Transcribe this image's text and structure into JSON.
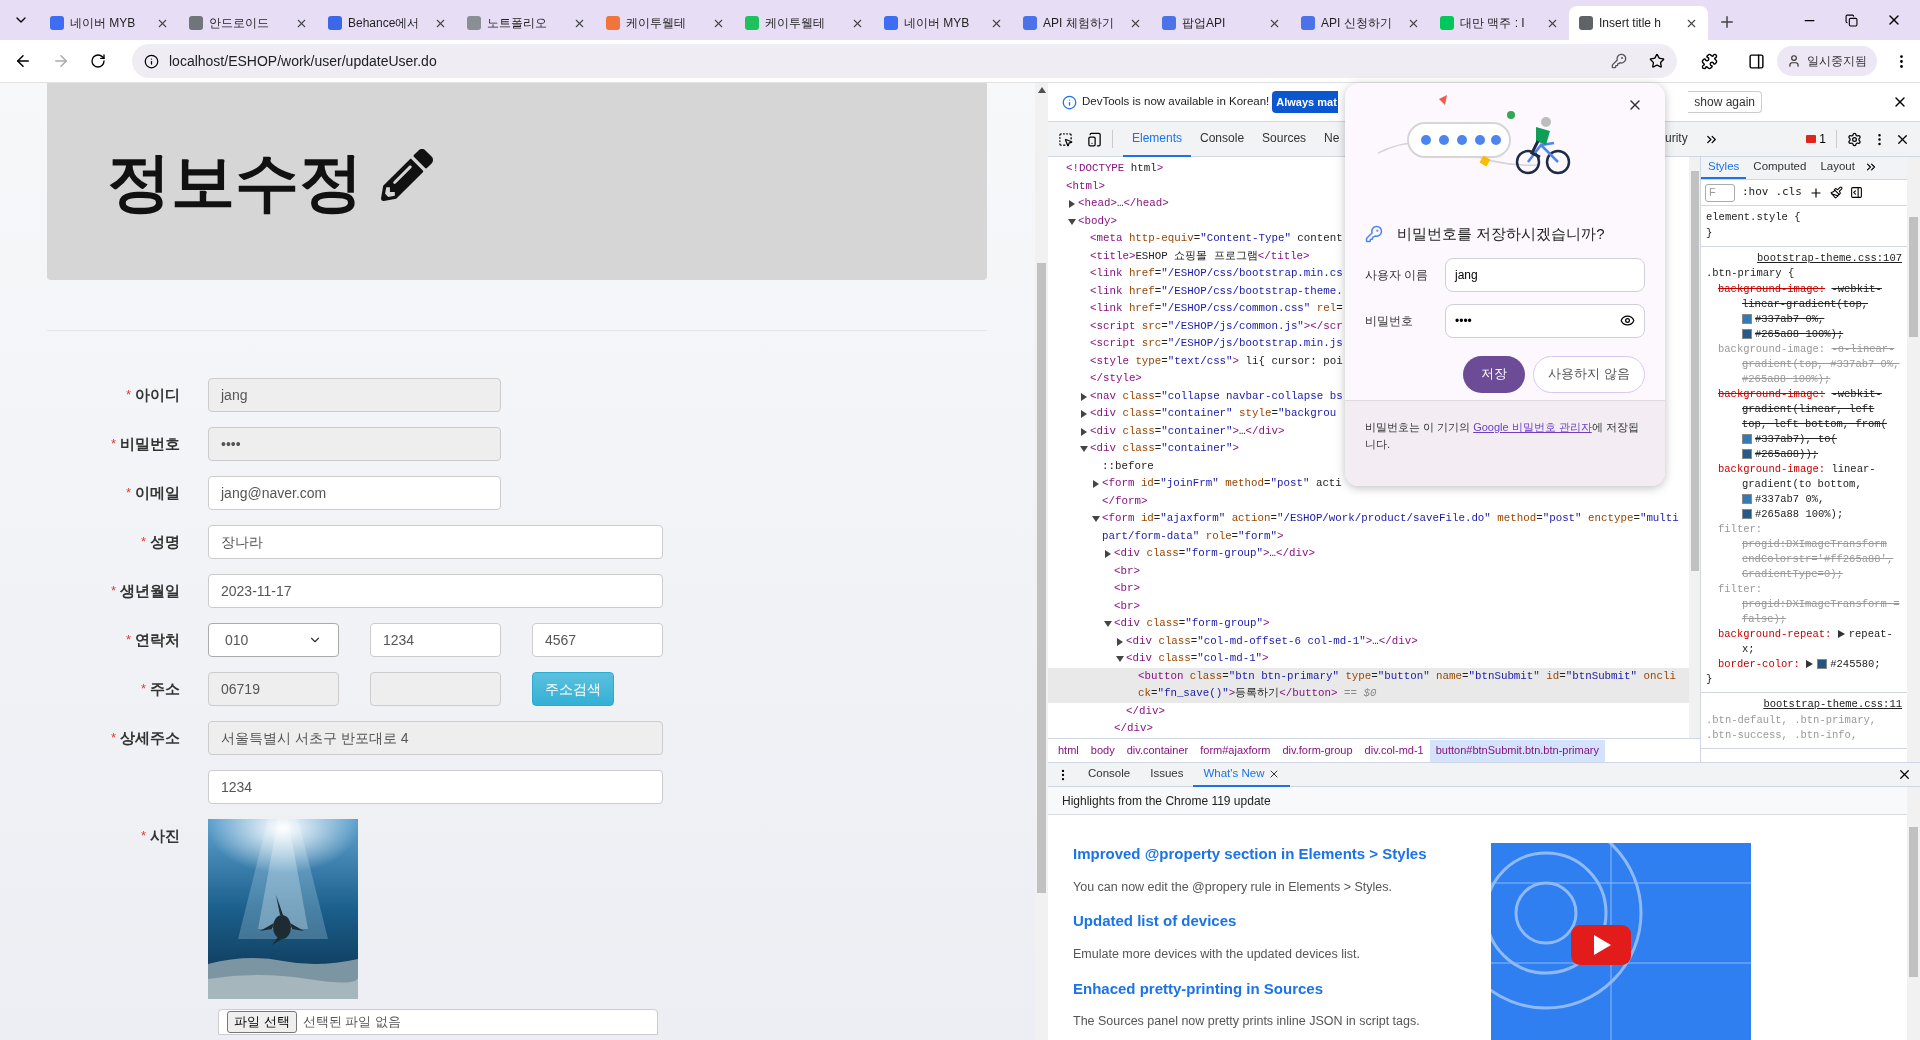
{
  "browser": {
    "tabs": [
      {
        "title": "네이버 MYB",
        "color": "#3d6df2",
        "selected": false
      },
      {
        "title": "안드로이드",
        "color": "#70757a",
        "selected": false
      },
      {
        "title": "Behance에서",
        "color": "#3b68e8",
        "selected": false
      },
      {
        "title": "노트폴리오",
        "color": "#8a8f94",
        "selected": false
      },
      {
        "title": "케이투웰테",
        "color": "#f0743c",
        "selected": false
      },
      {
        "title": "케이투웰테",
        "color": "#1fc15c",
        "selected": false
      },
      {
        "title": "네이버 MYB",
        "color": "#3d6df2",
        "selected": false
      },
      {
        "title": "API 체험하기",
        "color": "#4b72e8",
        "selected": false
      },
      {
        "title": "팝업API",
        "color": "#4b72e8",
        "selected": false
      },
      {
        "title": "API 신청하기",
        "color": "#4b72e8",
        "selected": false
      },
      {
        "title": "대만 맥주 : I",
        "color": "#03c75a",
        "selected": false
      },
      {
        "title": "Insert title h",
        "color": "#5f6368",
        "selected": true
      }
    ],
    "address": "localhost/ESHOP/work/user/updateUser.do",
    "profile": "일시중지됨"
  },
  "page": {
    "title": "정보수정",
    "rows": [
      {
        "label": "아이디",
        "mark": "*",
        "kind": "short",
        "fields": [
          {
            "kind": "input",
            "value": "jang",
            "disabled": true
          }
        ]
      },
      {
        "label": "비밀번호",
        "mark": "*",
        "kind": "short",
        "fields": [
          {
            "kind": "input",
            "value": "••••",
            "disabled": true
          }
        ]
      },
      {
        "label": "이메일",
        "mark": "*",
        "kind": "short",
        "fields": [
          {
            "kind": "input",
            "value": "jang@naver.com",
            "disabled": false
          }
        ]
      },
      {
        "label": "성명",
        "mark": "*",
        "kind": "wide",
        "fields": [
          {
            "kind": "input",
            "value": "장나라",
            "disabled": false
          }
        ]
      },
      {
        "label": "생년월일",
        "mark": "*",
        "kind": "wide",
        "fields": [
          {
            "kind": "input",
            "value": "2023-11-17",
            "disabled": false
          }
        ]
      },
      {
        "label": "연락처",
        "mark": "*",
        "kind": "triple",
        "fields": [
          {
            "kind": "select",
            "value": "010",
            "disabled": false
          },
          {
            "kind": "input",
            "value": "1234",
            "disabled": false
          },
          {
            "kind": "input",
            "value": "4567",
            "disabled": false
          }
        ]
      },
      {
        "label": "주소",
        "mark": "*",
        "kind": "triple",
        "fields": [
          {
            "kind": "input",
            "value": "06719",
            "disabled": true
          },
          {
            "kind": "input",
            "disabled": true
          },
          {
            "kind": "button",
            "value": "주소검색"
          }
        ]
      },
      {
        "label": "상세주소",
        "mark": "*",
        "kind": "wide",
        "fields": [
          {
            "kind": "input",
            "value": "서울특별시 서초구 반포대로 4",
            "disabled": true
          }
        ]
      },
      {
        "kind": "wide",
        "fields": [
          {
            "kind": "input",
            "value": "1234",
            "disabled": false
          }
        ]
      },
      {
        "label": "사진",
        "mark": "*"
      }
    ],
    "file": {
      "button": "파일 선택",
      "status": "선택된 파일 없음"
    }
  },
  "devtools": {
    "infobar": {
      "message": "DevTools is now available in Korean!",
      "primary": "Always mat",
      "secondary": "show again"
    },
    "tabs": [
      {
        "label": "Elements",
        "selected": true
      },
      {
        "label": "Console",
        "selected": false
      },
      {
        "label": "Sources",
        "selected": false
      },
      {
        "label": "Ne",
        "selected": false
      }
    ],
    "tab_right": {
      "label": "urity",
      "selected": false
    },
    "error_count": "1",
    "dom": [
      {
        "text": "<!DOCTYPE html>",
        "selected": false
      },
      {
        "text": "<html>",
        "selected": false,
        "children": [
          {
            "text": "<head>…</head>",
            "expanded": false,
            "selected": false
          },
          {
            "text": "<body>",
            "expanded": true,
            "selected": false,
            "children": [
              {
                "text": "<meta http-equiv=\"Content-Type\" content",
                "selected": false
              },
              {
                "text": "<title>ESHOP 쇼핑몰 프로그램</title>",
                "selected": false
              },
              {
                "text": "<link href=\"/ESHOP/css/bootstrap.min.cs",
                "selected": false
              },
              {
                "text": "<link href=\"/ESHOP/css/bootstrap-theme.",
                "selected": false
              },
              {
                "text": "<link href=\"/ESHOP/css/common.css\" rel=",
                "selected": false
              },
              {
                "text": "<script src=\"/ESHOP/js/common.js\"></scr",
                "selected": false
              },
              {
                "text": "<script src=\"/ESHOP/js/bootstrap.min.js",
                "selected": false
              },
              {
                "text": "<style type=\"text/css\"> li{ cursor: poi",
                "selected": false
              },
              {
                "text": "</style>",
                "selected": false
              },
              {
                "text": "<nav class=\"collapse navbar-collapse bs",
                "expanded": false,
                "selected": false
              },
              {
                "text": "<div class=\"container\" style=\"backgrou",
                "expanded": false,
                "selected": false
              },
              {
                "text": "<div class=\"container\">…</div>",
                "expanded": false,
                "selected": false
              },
              {
                "text": "<div class=\"container\">",
                "expanded": true,
                "selected": false,
                "children": [
                  {
                    "text": "::before",
                    "selected": false
                  },
                  {
                    "text": "<form id=\"joinFrm\" method=\"post\" acti",
                    "expanded": false,
                    "selected": false
                  },
                  {
                    "text": "</form>",
                    "selected": false
                  },
                  {
                    "text": "<form id=\"ajaxform\" action=\"/ESHOP/work/product/saveFile.do\" method=\"post\" enctype=\"multipart/form-data\" role=\"form\">",
                    "expanded": true,
                    "selected": false,
                    "children": [
                      {
                        "text": "<div class=\"form-group\">…</div>",
                        "expanded": false,
                        "selected": false
                      },
                      {
                        "text": "<br>",
                        "selected": false
                      },
                      {
                        "text": "<br>",
                        "selected": false
                      },
                      {
                        "text": "<br>",
                        "selected": false
                      },
                      {
                        "text": "<div class=\"form-group\">",
                        "expanded": true,
                        "selected": false,
                        "children": [
                          {
                            "text": "<div class=\"col-md-offset-6 col-md-1\">…</div>",
                            "expanded": false,
                            "selected": false
                          },
                          {
                            "text": "<div class=\"col-md-1\">",
                            "expanded": true,
                            "selected": false,
                            "children": [
                              {
                                "text": "<button class=\"btn btn-primary\" type=\"button\" name=\"btnSubmit\" id=\"btnSubmit\" onclick=\"fn_save()\">등록하기</button>",
                                "suffix": "== $0",
                                "selected": true
                              }
                            ]
                          },
                          {
                            "text": "</div>",
                            "selected": false
                          }
                        ]
                      },
                      {
                        "text": "</div>",
                        "selected": false
                      }
                    ]
                  }
                ]
              }
            ]
          }
        ]
      }
    ],
    "breadcrumbs": [
      {
        "label": "html",
        "selected": false
      },
      {
        "label": "body",
        "selected": false
      },
      {
        "label": "div.container",
        "selected": false
      },
      {
        "label": "form#ajaxform",
        "selected": false
      },
      {
        "label": "div.form-group",
        "selected": false
      },
      {
        "label": "div.col-md-1",
        "selected": false
      },
      {
        "label": "button#btnSubmit.btn.btn-primary",
        "selected": true
      }
    ],
    "styles": {
      "tabs": [
        {
          "label": "Styles",
          "selected": true
        },
        {
          "label": "Computed",
          "selected": false
        },
        {
          "label": "Layout",
          "selected": false
        }
      ],
      "filter_placeholder": "F",
      "toggles": [
        ":hov",
        ".cls"
      ],
      "rules": [
        {
          "selector": "element.style {",
          "close": "}"
        },
        {
          "selector": ".btn-primary {",
          "source": "bootstrap-theme.css:107",
          "close": "}",
          "declarations": [
            {
              "property": "background-image:",
              "kind": "overridden",
              "expandable": false,
              "parts": [
                {
                  "text": "-webkit-linear-gradient(top,"
                },
                {
                  "text": "#337ab7 0%,",
                  "color": "#337ab7"
                },
                {
                  "text": "#265a88 100%);",
                  "color": "#265a88"
                }
              ]
            },
            {
              "property": "background-image:",
              "kind": "invalid",
              "expandable": false,
              "parts": [
                {
                  "text": "-o-linear-gradient(top, #337ab7 0%, #265a88 100%);"
                }
              ]
            },
            {
              "property": "background-image:",
              "kind": "overridden",
              "expandable": false,
              "parts": [
                {
                  "text": "-webkit-gradient(linear, left top, left bottom, from("
                },
                {
                  "text": "#337ab7), to(",
                  "color": "#337ab7"
                },
                {
                  "text": "#265a88));",
                  "color": "#265a88"
                }
              ]
            },
            {
              "property": "background-image:",
              "kind": "active",
              "expandable": false,
              "parts": [
                {
                  "text": "linear-gradient(to bottom,"
                },
                {
                  "text": "#337ab7 0%,",
                  "color": "#337ab7"
                },
                {
                  "text": "#265a88 100%);",
                  "color": "#265a88"
                }
              ]
            },
            {
              "property": "filter:",
              "kind": "invalid",
              "expandable": false,
              "parts": [
                {
                  "text": "progid:DXImageTransform endColorstr='#ff265a88', GradientType=0);"
                }
              ]
            },
            {
              "property": "filter:",
              "kind": "invalid",
              "expandable": false,
              "parts": [
                {
                  "text": "progid:DXImageTransform = false);"
                }
              ]
            },
            {
              "property": "background-repeat:",
              "kind": "active",
              "expandable": true,
              "parts": [
                {
                  "text": "repeat-x;"
                }
              ]
            },
            {
              "property": "border-color:",
              "kind": "active",
              "expandable": true,
              "parts": [
                {
                  "text": "#245580;",
                  "color": "#245580"
                }
              ]
            }
          ]
        },
        {
          "selector": ".btn-default, .btn-primary, .btn-success, .btn-info,",
          "source": "bootstrap-theme.css:11"
        }
      ]
    },
    "drawer": {
      "tabs": [
        {
          "label": "Console",
          "selected": false,
          "closable": false
        },
        {
          "label": "Issues",
          "selected": false,
          "closable": false
        },
        {
          "label": "What's New",
          "selected": true,
          "closable": true
        }
      ],
      "header": "Highlights from the Chrome 119 update",
      "articles": [
        {
          "heading": "Improved @property section in Elements > Styles",
          "text": "You can now edit the @propery rule in Elements > Styles."
        },
        {
          "heading": "Updated list of devices",
          "text": "Emulate more devices with the updated devices list."
        },
        {
          "heading": "Enhaced pretty-printing in Sources",
          "text": "The Sources panel now pretty prints inline JSON in script tags."
        }
      ]
    }
  },
  "password_prompt": {
    "title": "비밀번호를 저장하시겠습니까?",
    "username_label": "사용자 이름",
    "username": "jang",
    "password_label": "비밀번호",
    "password": "••••",
    "save": "저장",
    "never": "사용하지 않음",
    "footer": {
      "before": "비밀번호는 이 기기의 ",
      "link": "Google 비밀번호 관리자",
      "after": "에 저장됩니다."
    }
  }
}
